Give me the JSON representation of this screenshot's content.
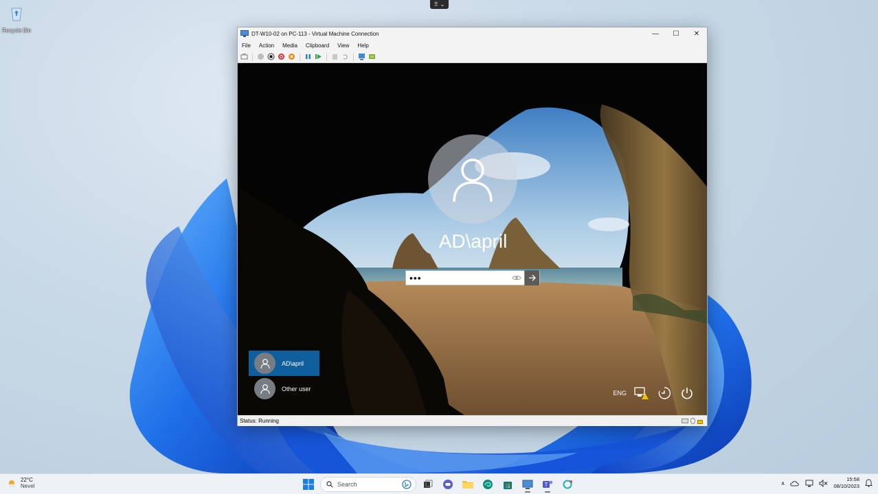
{
  "desktop": {
    "recycle_bin_label": "Recycle Bin"
  },
  "vm_window": {
    "title": "DT-W10-02 on PC-113 - Virtual Machine Connection",
    "controls": {
      "minimize": "—",
      "maximize": "☐",
      "close": "✕"
    },
    "menu": [
      "File",
      "Action",
      "Media",
      "Clipboard",
      "View",
      "Help"
    ],
    "status": "Status: Running"
  },
  "lock_screen": {
    "user_name": "AD\\april",
    "password_mask": "•••",
    "users": [
      {
        "label": "AD\\april",
        "selected": true
      },
      {
        "label": "Other user",
        "selected": false
      }
    ],
    "language": "ENG"
  },
  "taskbar": {
    "weather_temp": "22°C",
    "weather_desc": "Nevel",
    "search_placeholder": "Search",
    "time": "15:58",
    "date": "08/10/2023"
  },
  "colors": {
    "selected_user_bg": "#0f5f9e",
    "accent_blue": "#1a63d6"
  }
}
